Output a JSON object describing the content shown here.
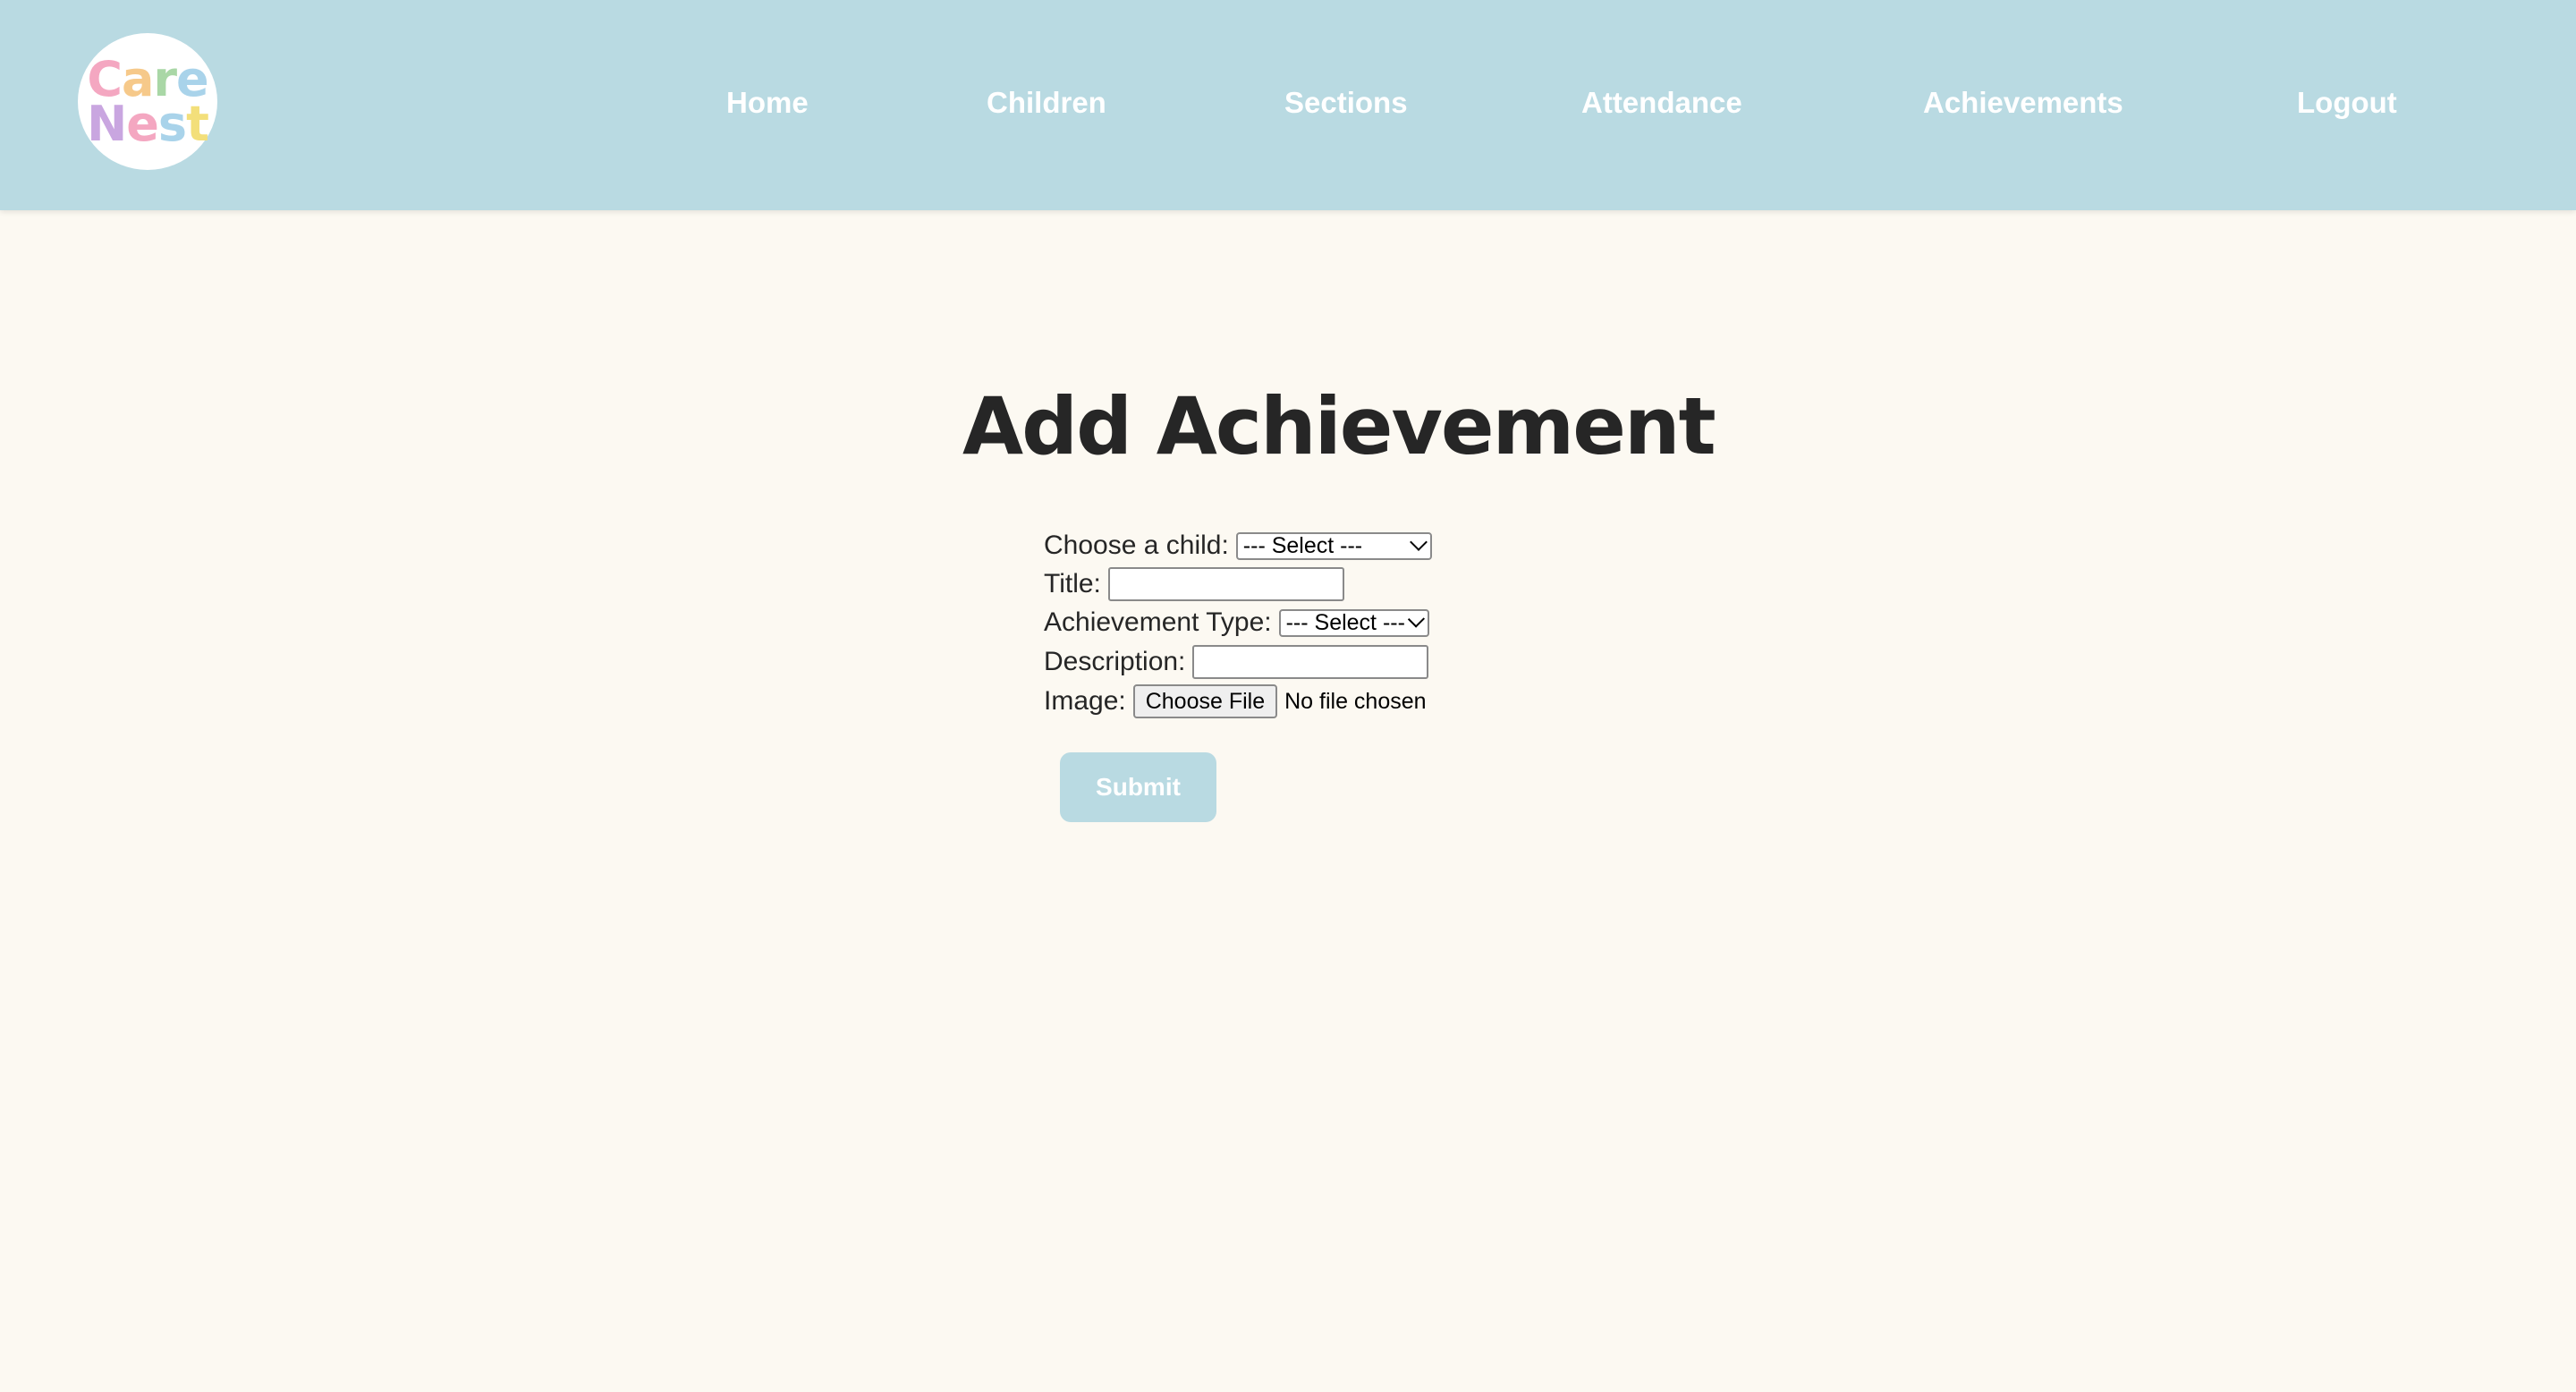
{
  "brand": {
    "logo_line1": [
      "C",
      "a",
      "r",
      "e"
    ],
    "logo_line2": [
      "N",
      "e",
      "s",
      "t"
    ],
    "logo_colors_line1": [
      "#f4a7c1",
      "#f6c98a",
      "#a9d7a6",
      "#a9d3ea"
    ],
    "logo_colors_line2": [
      "#c9a6e0",
      "#f4a7c1",
      "#a9d3ea",
      "#f3df7a"
    ]
  },
  "nav": {
    "home": "Home",
    "children": "Children",
    "sections": "Sections",
    "attendance": "Attendance",
    "achievements": "Achievements",
    "logout": "Logout"
  },
  "page": {
    "title": "Add Achievement"
  },
  "form": {
    "child_label": "Choose a child:",
    "child_select_value": "--- Select ---",
    "title_label": "Title:",
    "title_value": "",
    "type_label": "Achievement Type:",
    "type_select_value": "--- Select ---",
    "description_label": "Description:",
    "description_value": "",
    "image_label": "Image:",
    "file_button": "Choose File",
    "file_status": "No file chosen",
    "submit_label": "Submit"
  },
  "colors": {
    "header_bg": "#b9dae2",
    "page_bg": "#fcf9f2",
    "title_text": "#262626",
    "nav_text": "#ffffff",
    "submit_bg": "#b9dae2"
  }
}
